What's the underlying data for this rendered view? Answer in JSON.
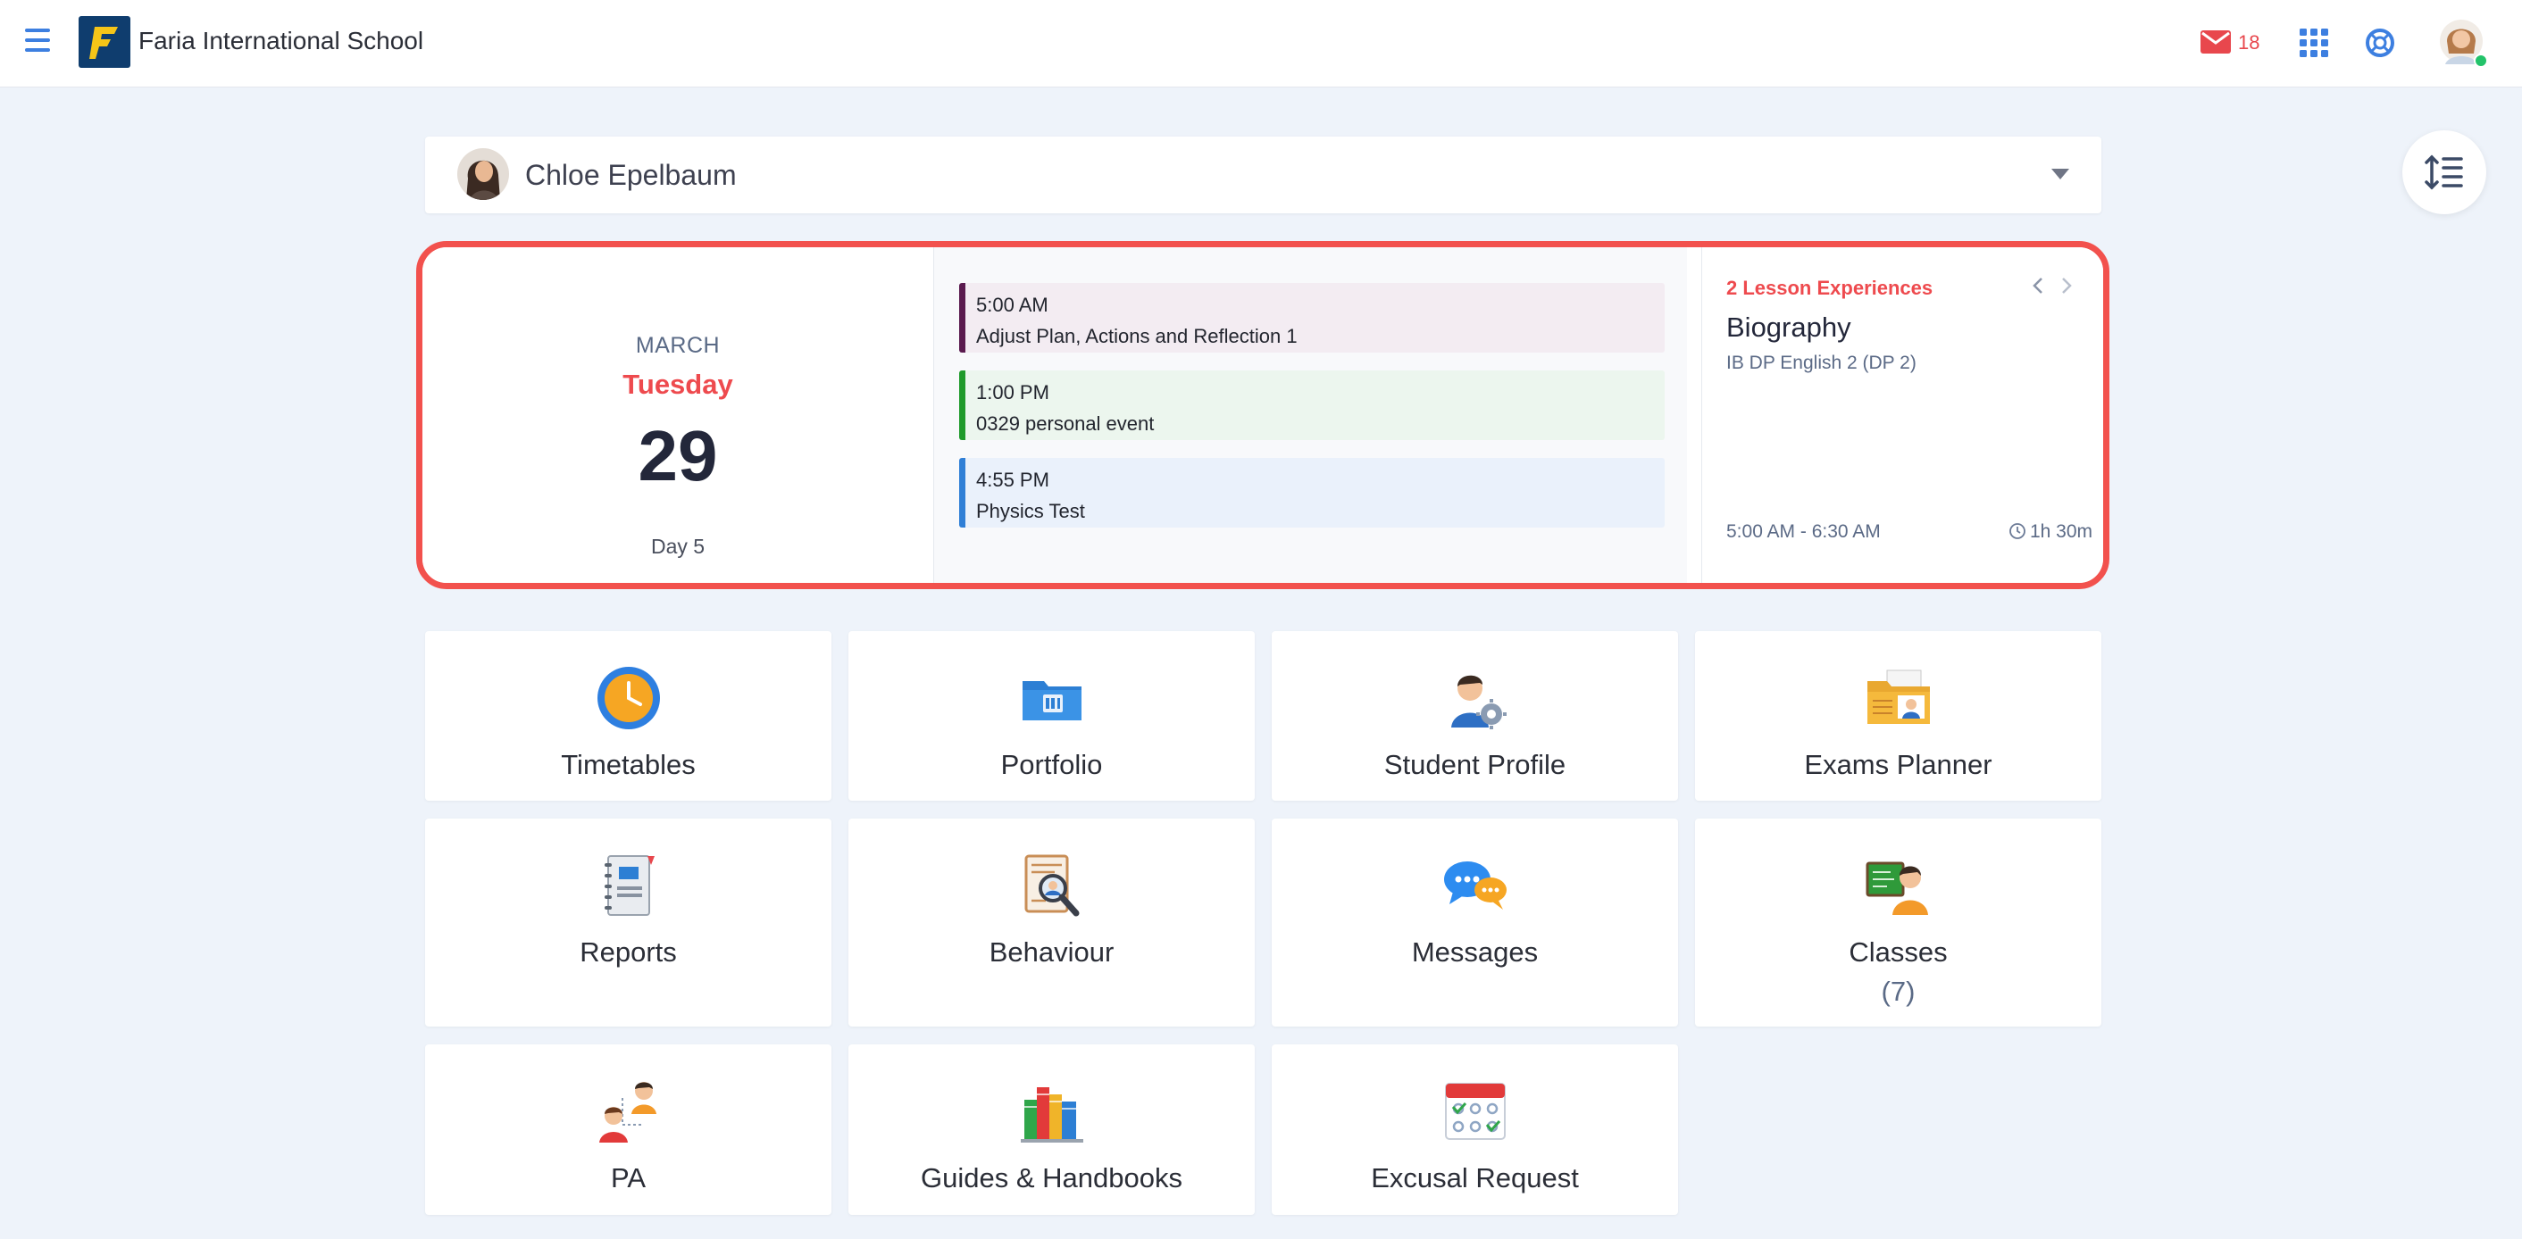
{
  "header": {
    "app_title": "Faria International School",
    "logo_letter": "F",
    "mail_count": "18",
    "icons": [
      "menu-icon",
      "mail-icon",
      "apps-grid-icon",
      "help-lifebuoy-icon",
      "user-avatar"
    ]
  },
  "student_selector": {
    "name": "Chloe Epelbaum"
  },
  "calendar": {
    "month": "MARCH",
    "weekday": "Tuesday",
    "day": "29",
    "cycle_day": "Day 5",
    "events": [
      {
        "time": "5:00 AM",
        "title": "Adjust Plan, Actions and Reflection 1",
        "color": "#5a1a4e",
        "bg": "#f3ecf2"
      },
      {
        "time": "1:00 PM",
        "title": "0329 personal event",
        "color": "#1f9a2b",
        "bg": "#ecf6ee"
      },
      {
        "time": "4:55 PM",
        "title": "Physics Test",
        "color": "#2f7fd6",
        "bg": "#eaf1fb"
      }
    ],
    "lesson": {
      "count_label": "2 Lesson Experiences",
      "title": "Biography",
      "class": "IB DP English 2 (DP 2)",
      "time_range": "5:00 AM - 6:30 AM",
      "duration": "1h 30m"
    }
  },
  "tiles": [
    {
      "label": "Timetables",
      "icon": "clock-icon"
    },
    {
      "label": "Portfolio",
      "icon": "folder-icon"
    },
    {
      "label": "Student Profile",
      "icon": "student-profile-icon"
    },
    {
      "label": "Exams Planner",
      "icon": "exams-folder-icon"
    },
    {
      "label": "Reports",
      "icon": "report-cards-icon"
    },
    {
      "label": "Behaviour",
      "icon": "behaviour-magnifier-icon"
    },
    {
      "label": "Messages",
      "icon": "chat-bubbles-icon"
    },
    {
      "label": "Classes",
      "icon": "classes-board-icon",
      "count": "(7)"
    },
    {
      "label": "PA",
      "icon": "parents-icon"
    },
    {
      "label": "Guides & Handbooks",
      "icon": "books-icon"
    },
    {
      "label": "Excusal Request",
      "icon": "attendance-calendar-icon"
    }
  ],
  "colors": {
    "accent_red": "#ee4a4e",
    "link_blue": "#3d7fe0",
    "page_bg": "#eef3fa"
  }
}
